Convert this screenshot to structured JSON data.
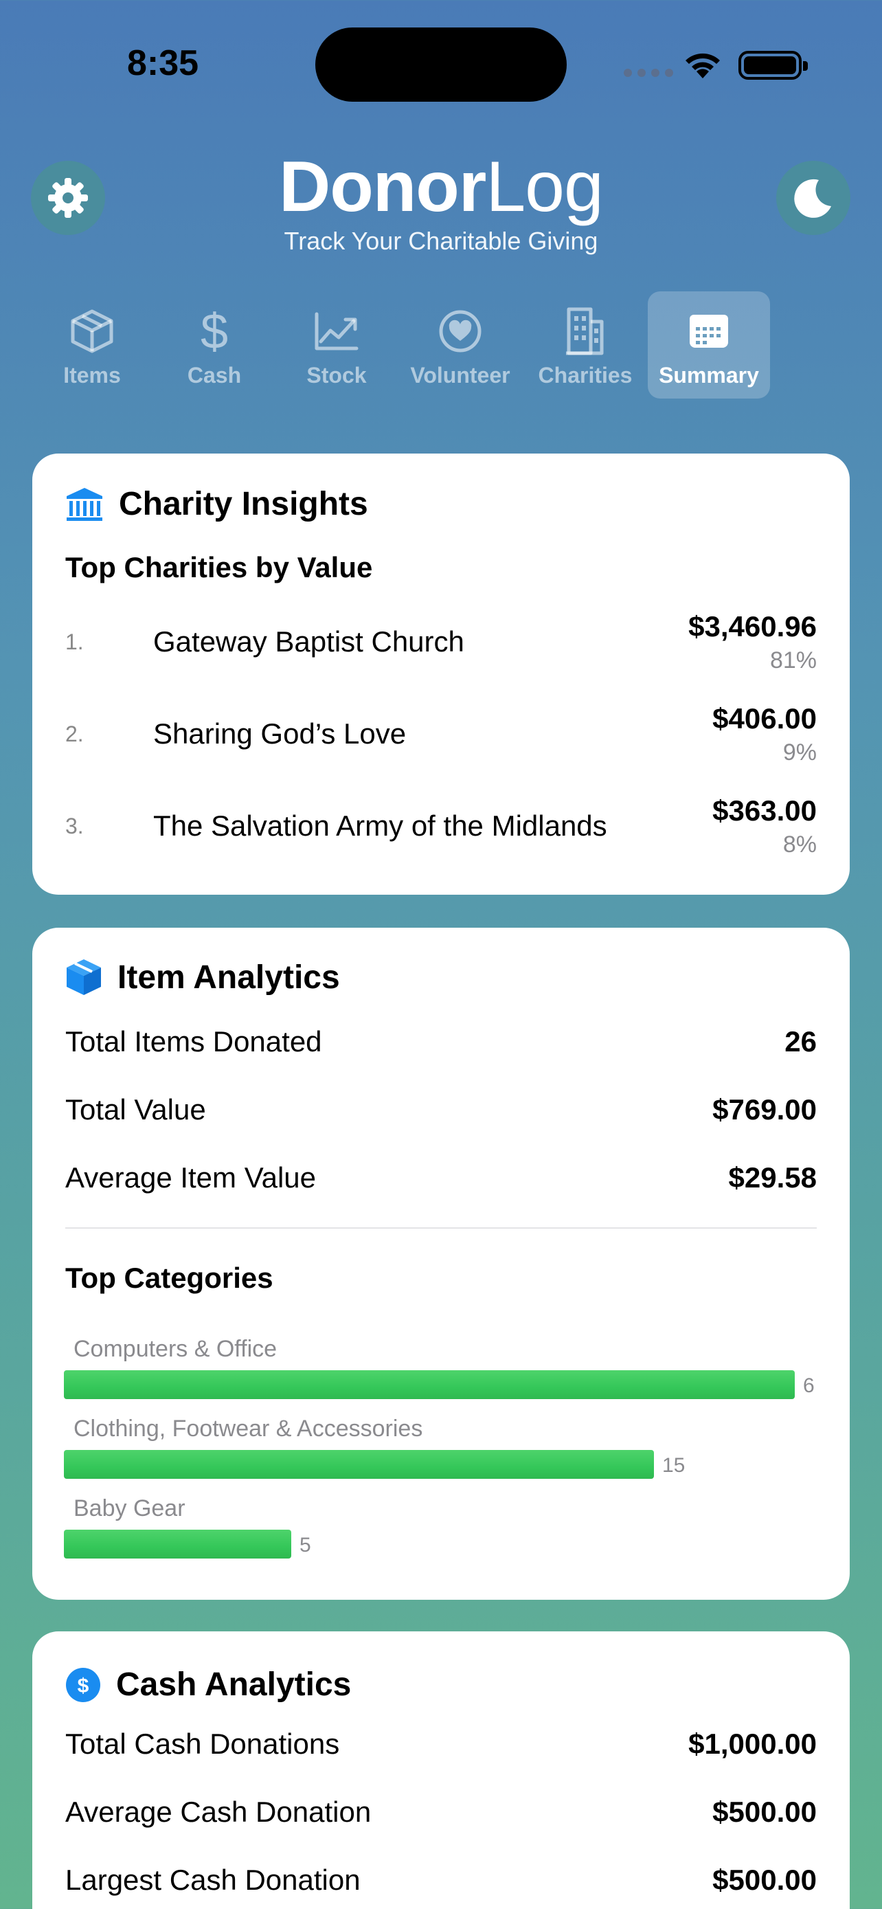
{
  "status": {
    "time": "8:35"
  },
  "brand": {
    "title_bold": "Donor",
    "title_light": "Log",
    "subtitle": "Track Your Charitable Giving"
  },
  "tabs": [
    {
      "label": "Items",
      "icon": "box-icon",
      "active": false
    },
    {
      "label": "Cash",
      "icon": "dollar-icon",
      "active": false
    },
    {
      "label": "Stock",
      "icon": "chart-line-icon",
      "active": false
    },
    {
      "label": "Volunteer",
      "icon": "heart-icon",
      "active": false
    },
    {
      "label": "Charities",
      "icon": "building-icon",
      "active": false
    },
    {
      "label": "Summary",
      "icon": "calendar-icon",
      "active": true
    }
  ],
  "charity_insights": {
    "title": "Charity Insights",
    "section": "Top Charities by Value",
    "items": [
      {
        "rank": "1.",
        "name": "Gateway Baptist Church",
        "amount": "$3,460.96",
        "percent": "81%"
      },
      {
        "rank": "2.",
        "name": "Sharing God’s Love",
        "amount": "$406.00",
        "percent": "9%"
      },
      {
        "rank": "3.",
        "name": "The Salvation Army of the Midlands",
        "amount": "$363.00",
        "percent": "8%"
      }
    ]
  },
  "item_analytics": {
    "title": "Item Analytics",
    "stats": [
      {
        "label": "Total Items Donated",
        "value": "26"
      },
      {
        "label": "Total Value",
        "value": "$769.00"
      },
      {
        "label": "Average Item Value",
        "value": "$29.58"
      }
    ],
    "categories_title": "Top Categories",
    "categories": [
      {
        "label": "Computers & Office",
        "count": "6",
        "fraction": 1.0
      },
      {
        "label": "Clothing, Footwear & Accessories",
        "count": "15",
        "fraction": 0.807
      },
      {
        "label": "Baby Gear",
        "count": "5",
        "fraction": 0.311
      }
    ],
    "colors": {
      "bar": "#34c759",
      "icon": "#1a8cf0"
    }
  },
  "cash_analytics": {
    "title": "Cash Analytics",
    "stats": [
      {
        "label": "Total Cash Donations",
        "value": "$1,000.00"
      },
      {
        "label": "Average Cash Donation",
        "value": "$500.00"
      },
      {
        "label": "Largest Cash Donation",
        "value": "$500.00"
      }
    ]
  }
}
